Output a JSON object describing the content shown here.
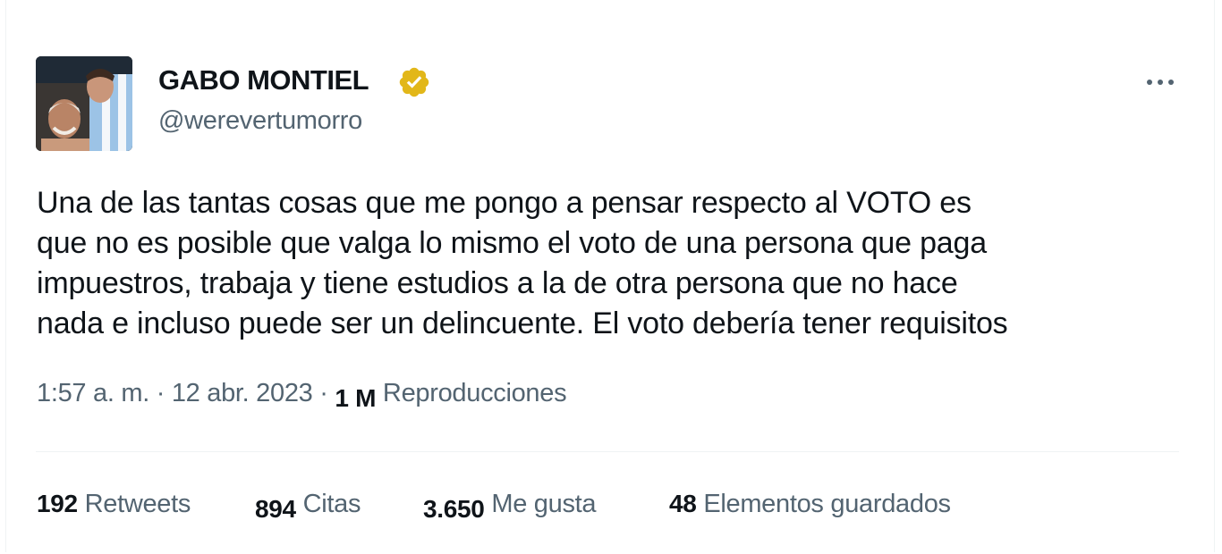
{
  "tweet": {
    "author": {
      "name": "GABO MONTIEL",
      "handle": "@werevertumorro",
      "verified": true,
      "verified_badge_color": "#e2b719"
    },
    "more_icon": "more-horizontal-icon",
    "text_lines": [
      "Una de las tantas cosas que me pongo a pensar respecto al VOTO es",
      "que no es posible que valga lo mismo el voto de una persona que paga",
      "impuestros, trabaja y tiene estudios a la de otra persona que no hace",
      "nada e incluso puede ser un delincuente. El voto debería tener requisitos"
    ],
    "time": "1:57 a. m.",
    "separator": " · ",
    "date": "12 abr. 2023",
    "views_count": "1 M",
    "views_label": "Reproducciones",
    "stats": {
      "retweets": {
        "count": "192",
        "label": "Retweets"
      },
      "quotes": {
        "count": "894",
        "label": "Citas"
      },
      "likes": {
        "count": "3.650",
        "label": "Me gusta"
      },
      "bookmarks": {
        "count": "48",
        "label": "Elementos guardados"
      }
    }
  },
  "colors": {
    "text_primary": "#0f1419",
    "text_secondary": "#536471",
    "divider": "#eff3f4"
  }
}
